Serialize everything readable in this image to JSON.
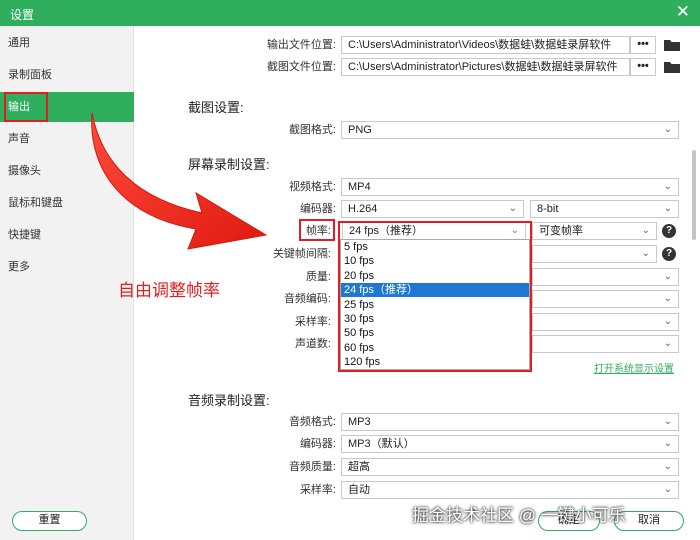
{
  "window": {
    "title": "设置",
    "close_glyph": "✕"
  },
  "sidebar": {
    "items": [
      {
        "label": "通用"
      },
      {
        "label": "录制面板"
      },
      {
        "label": "输出",
        "active": true
      },
      {
        "label": "声音"
      },
      {
        "label": "摄像头"
      },
      {
        "label": "鼠标和键盘"
      },
      {
        "label": "快捷键"
      },
      {
        "label": "更多"
      }
    ]
  },
  "output": {
    "output_path_label": "输出文件位置:",
    "output_path": "C:\\Users\\Administrator\\Videos\\数据蛙\\数据蛙录屏软件",
    "screenshot_path_label": "截图文件位置:",
    "screenshot_path": "C:\\Users\\Administrator\\Pictures\\数据蛙\\数据蛙录屏软件",
    "browse_label": "•••"
  },
  "screenshot_settings": {
    "title": "截图设置:",
    "format_label": "截图格式:",
    "format_value": "PNG"
  },
  "screen_recording": {
    "title": "屏幕录制设置:",
    "video_format_label": "视频格式:",
    "video_format_value": "MP4",
    "encoder_label": "编码器:",
    "encoder_value": "H.264",
    "bit_depth_value": "8-bit",
    "framerate_label": "帧率:",
    "framerate_value": "24 fps（推荐）",
    "framerate_mode_value": "可变帧率",
    "keyframe_label": "关键帧间隔:",
    "quality_label": "质量:",
    "audio_codec_label": "音频编码:",
    "sample_rate_label": "采样率:",
    "channels_label": "声道数:",
    "display_settings_link": "打开系统显示设置",
    "help_glyph": "?"
  },
  "framerate_options": [
    {
      "label": "5 fps"
    },
    {
      "label": "10 fps"
    },
    {
      "label": "20 fps"
    },
    {
      "label": "24 fps（推荐）",
      "selected": true
    },
    {
      "label": "25 fps"
    },
    {
      "label": "30 fps"
    },
    {
      "label": "50 fps"
    },
    {
      "label": "60 fps"
    },
    {
      "label": "120 fps"
    }
  ],
  "audio_recording": {
    "title": "音频录制设置:",
    "format_label": "音频格式:",
    "format_value": "MP3",
    "encoder_label": "编码器:",
    "encoder_value": "MP3（默认）",
    "quality_label": "音频质量:",
    "quality_value": "超高",
    "sample_rate_label": "采样率:",
    "sample_rate_value": "自动"
  },
  "annotation": {
    "text": "自由调整帧率"
  },
  "footer": {
    "reset_label": "重置",
    "ok_label": "确定",
    "cancel_label": "取消"
  },
  "watermark": "掘金技术社区 @ 一键小可乐",
  "colors": {
    "accent": "#2faf5e",
    "annotation": "#e02020",
    "selection": "#1e78d2"
  },
  "chevron_glyph": "⌄"
}
